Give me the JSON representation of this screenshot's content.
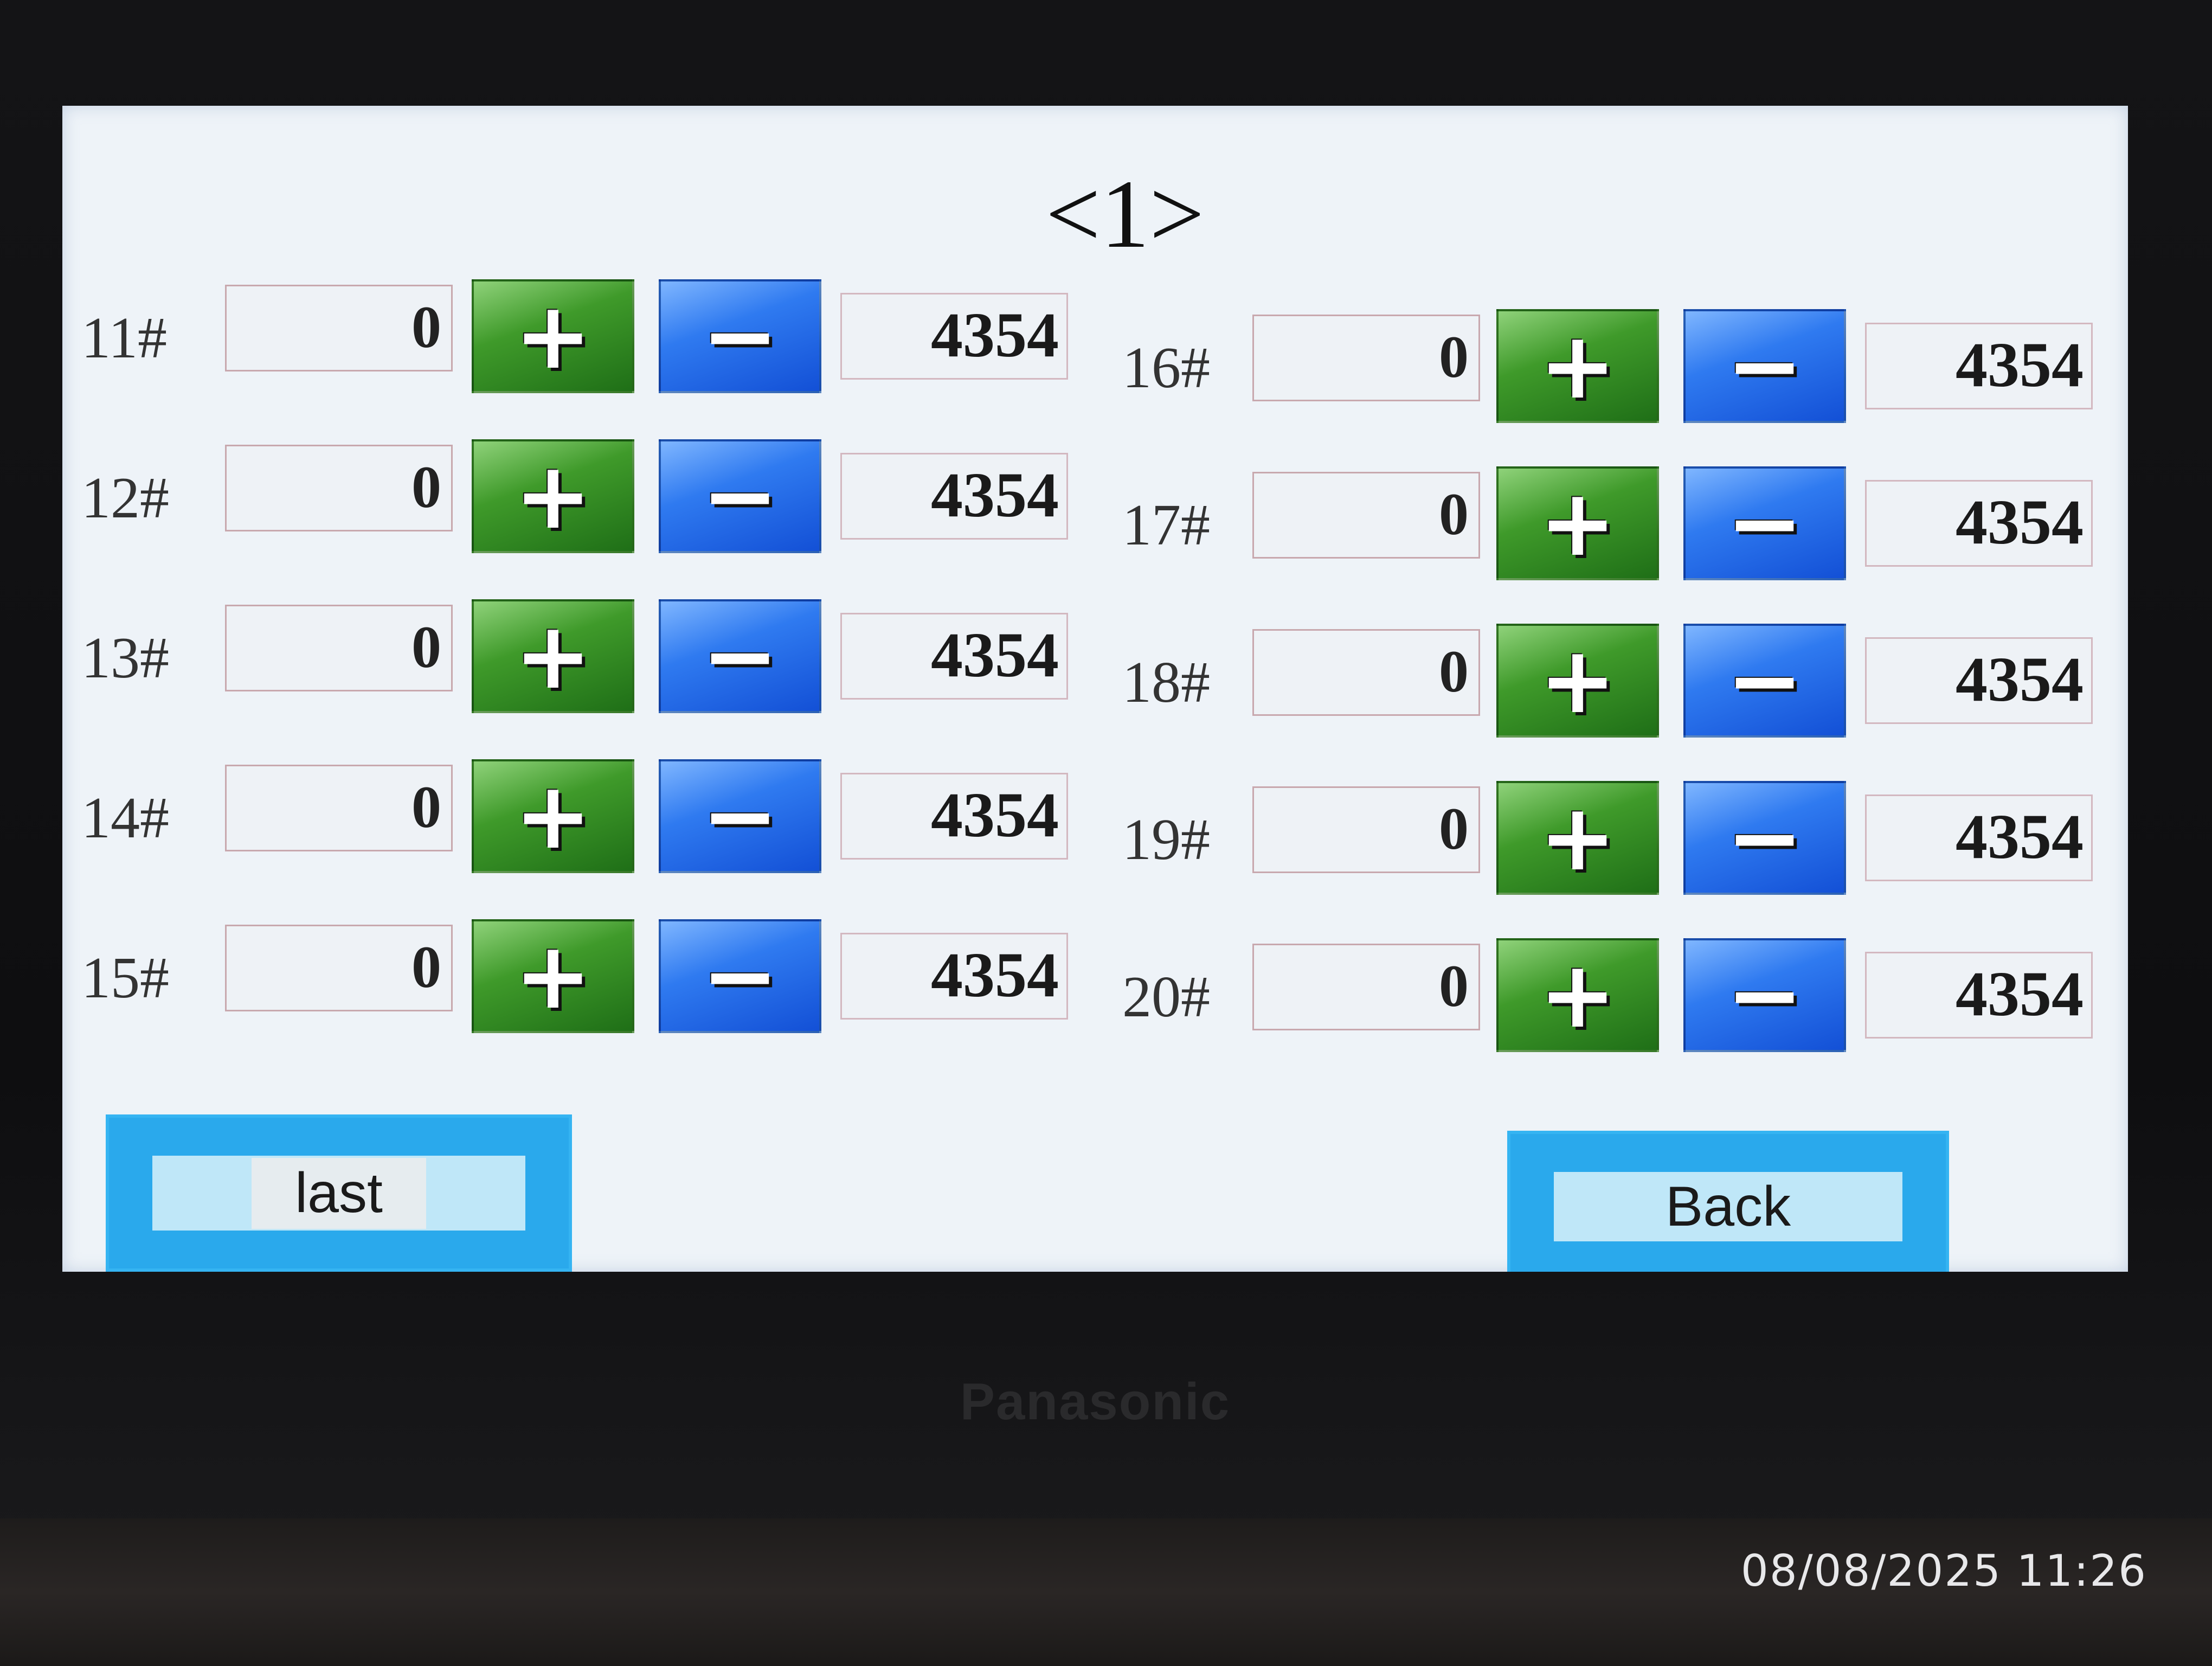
{
  "screen": {
    "page_title": "<1>",
    "left_column": [
      {
        "label": "11#",
        "count": "0",
        "plus": "+",
        "minus": "−",
        "total": "4354"
      },
      {
        "label": "12#",
        "count": "0",
        "plus": "+",
        "minus": "−",
        "total": "4354"
      },
      {
        "label": "13#",
        "count": "0",
        "plus": "+",
        "minus": "−",
        "total": "4354"
      },
      {
        "label": "14#",
        "count": "0",
        "plus": "+",
        "minus": "−",
        "total": "4354"
      },
      {
        "label": "15#",
        "count": "0",
        "plus": "+",
        "minus": "−",
        "total": "4354"
      }
    ],
    "right_column": [
      {
        "label": "16#",
        "count": "0",
        "plus": "+",
        "minus": "−",
        "total": "4354"
      },
      {
        "label": "17#",
        "count": "0",
        "plus": "+",
        "minus": "−",
        "total": "4354"
      },
      {
        "label": "18#",
        "count": "0",
        "plus": "+",
        "minus": "−",
        "total": "4354"
      },
      {
        "label": "19#",
        "count": "0",
        "plus": "+",
        "minus": "−",
        "total": "4354"
      },
      {
        "label": "20#",
        "count": "0",
        "plus": "+",
        "minus": "−",
        "total": "4354"
      }
    ],
    "last_button": "last",
    "back_button": "Back"
  },
  "device": {
    "brand": "Panasonic"
  },
  "photo_timestamp": "08/08/2025 11:26",
  "colors": {
    "plus_button": "#3f9a2a",
    "minus_button": "#2f7af0",
    "nav_button": "#2aa9ec",
    "screen_background": "#eef3f8"
  },
  "icons": {
    "plus": "plus-icon",
    "minus": "minus-icon"
  }
}
